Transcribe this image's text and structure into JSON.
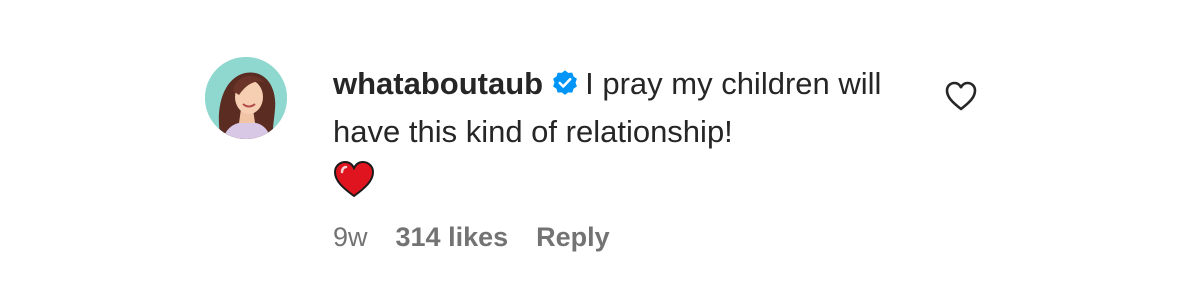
{
  "comment": {
    "username": "whataboutaub",
    "verified": true,
    "text": "I pray my children will have this kind of relationship!",
    "emoji": "red-heart",
    "time_ago": "9w",
    "likes_label": "314 likes",
    "reply_label": "Reply",
    "like_icon": "heart-outline-icon",
    "verified_icon": "verified-badge-icon",
    "colors": {
      "verified_badge": "#0095f6",
      "primary_text": "#262626",
      "secondary_text": "#737373",
      "heart_emoji": "#e0141e"
    }
  }
}
